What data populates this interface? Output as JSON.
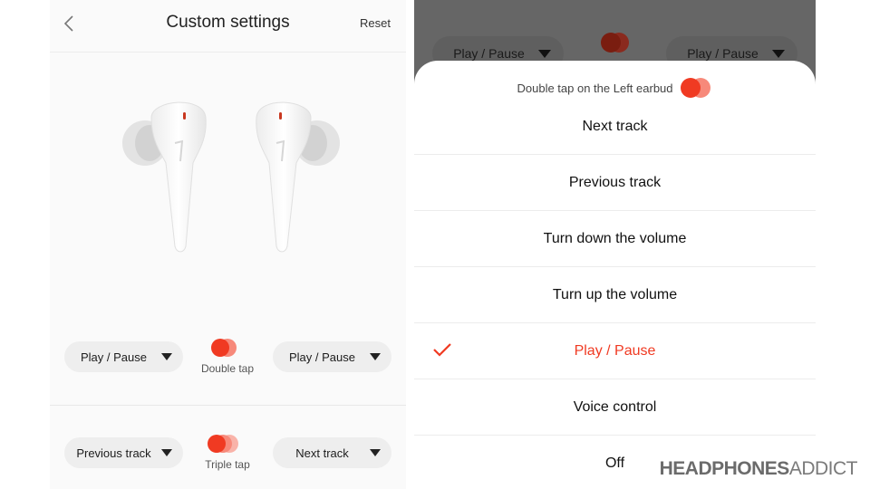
{
  "left_screen": {
    "header": {
      "title": "Custom settings",
      "reset_label": "Reset",
      "back_icon": "chevron-left-icon"
    },
    "earbuds_image": "earbuds-white-pair",
    "gestures": [
      {
        "label": "Double tap",
        "tap_count": 2,
        "left_action": "Play / Pause",
        "right_action": "Play / Pause"
      },
      {
        "label": "Triple tap",
        "tap_count": 3,
        "left_action": "Previous track",
        "right_action": "Next track"
      }
    ]
  },
  "right_screen": {
    "background_row": {
      "left_action": "Play / Pause",
      "right_action": "Play / Pause"
    },
    "sheet": {
      "header": "Double tap on the Left earbud",
      "options": [
        {
          "label": "Next track",
          "selected": false
        },
        {
          "label": "Previous track",
          "selected": false
        },
        {
          "label": "Turn down the volume",
          "selected": false
        },
        {
          "label": "Turn up the volume",
          "selected": false
        },
        {
          "label": "Play / Pause",
          "selected": true
        },
        {
          "label": "Voice control",
          "selected": false
        },
        {
          "label": "Off",
          "selected": false
        }
      ],
      "selected_icon": "checkmark-icon"
    }
  },
  "watermark": {
    "bold": "HEADPHONES",
    "thin": "ADDICT"
  },
  "colors": {
    "accent": "#f03a22",
    "accent_light": "#f7897a",
    "accent_lighter": "#f9b3a9",
    "dim_overlay": "#666666",
    "pill_bg": "#eeeeee"
  }
}
